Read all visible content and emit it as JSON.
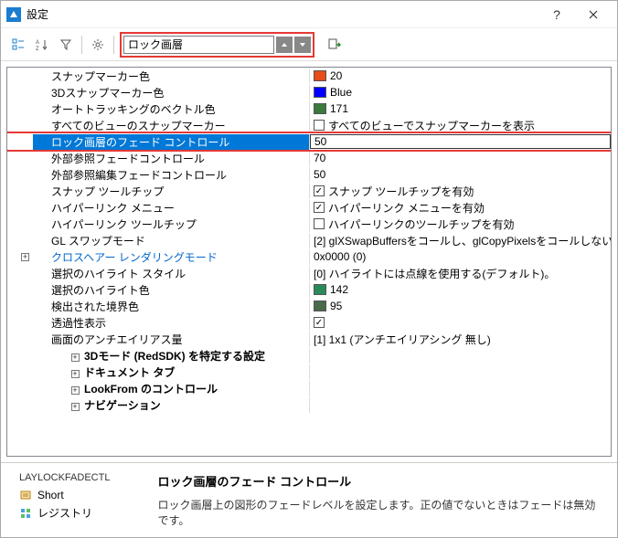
{
  "window": {
    "title": "設定"
  },
  "toolbar": {
    "search_value": "ロック画層"
  },
  "rows": [
    {
      "label": "スナップマーカー色",
      "value_text": "20",
      "swatch": "#e74c1a"
    },
    {
      "label": "3Dスナップマーカー色",
      "value_text": "Blue",
      "swatch": "#0000ff"
    },
    {
      "label": "オートトラッキングのベクトル色",
      "value_text": "171",
      "swatch": "#3a7a3a"
    },
    {
      "label": "すべてのビューのスナップマーカー",
      "value_text": "すべてのビューでスナップマーカーを表示",
      "checkbox": true,
      "checked": false
    },
    {
      "label": "ロック画層のフェード コントロール",
      "value_text": "50",
      "selected": true,
      "highlighted": true,
      "editing": true
    },
    {
      "label": "外部参照フェードコントロール",
      "value_text": "70"
    },
    {
      "label": "外部参照編集フェードコントロール",
      "value_text": "50"
    },
    {
      "label": "スナップ ツールチップ",
      "value_text": "スナップ ツールチップを有効",
      "checkbox": true,
      "checked": true
    },
    {
      "label": "ハイパーリンク メニュー",
      "value_text": "ハイパーリンク メニューを有効",
      "checkbox": true,
      "checked": true
    },
    {
      "label": "ハイパーリンク ツールチップ",
      "value_text": "ハイパーリンクのツールチップを有効",
      "checkbox": true,
      "checked": false
    },
    {
      "label": "GL スワップモード",
      "value_text": "[2] glXSwapBuffersをコールし、glCopyPixelsをコールしない。"
    },
    {
      "label": "クロスヘアー レンダリングモード",
      "value_text": "0x0000 (0)",
      "link": true,
      "expand": "+",
      "label_indent": 0
    },
    {
      "label": "選択のハイライト スタイル",
      "value_text": "[0] ハイライトには点線を使用する(デフォルト)。"
    },
    {
      "label": "選択のハイライト色",
      "value_text": "142",
      "swatch": "#2a8a5a"
    },
    {
      "label": "検出された境界色",
      "value_text": "95",
      "swatch": "#4a6a4a"
    },
    {
      "label": "透過性表示",
      "value_text": "",
      "checkbox": true,
      "checked": true
    },
    {
      "label": "画面のアンチエイリアス量",
      "value_text": "[1] 1x1 (アンチエイリアシング 無し)"
    },
    {
      "label": "3Dモード (RedSDK) を特定する設定",
      "sub": true,
      "expand": "+"
    },
    {
      "label": "ドキュメント タブ",
      "sub": true,
      "expand": "+"
    },
    {
      "label": "LookFrom のコントロール",
      "sub": true,
      "expand": "+"
    },
    {
      "label": "ナビゲーション",
      "sub": true,
      "expand": "+"
    }
  ],
  "footer": {
    "command": "LAYLOCKFADECTL",
    "short_label": "Short",
    "registry_label": "レジストリ",
    "title": "ロック画層のフェード コントロール",
    "desc": "ロック画層上の図形のフェードレベルを設定します。正の値でないときはフェードは無効です。"
  }
}
